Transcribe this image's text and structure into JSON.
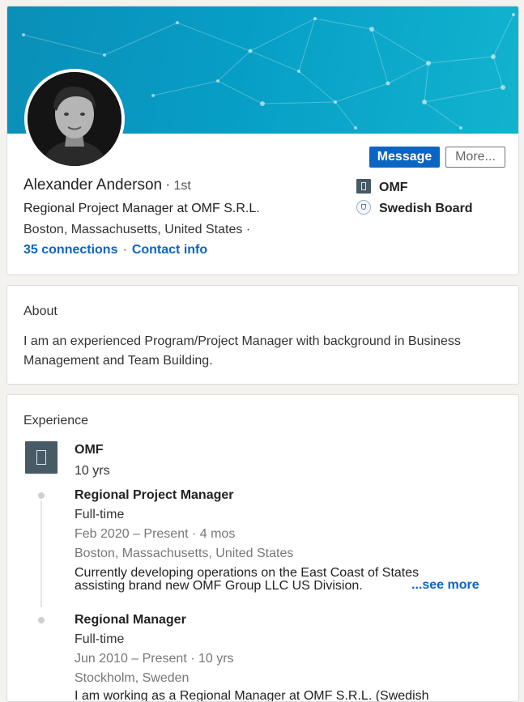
{
  "profile": {
    "name": "Alexander Anderson",
    "degree": "1st",
    "headline": "Regional Project Manager at OMF S.R.L.",
    "location": "Boston, Massachusetts, United States",
    "connections": "35 connections",
    "contact_info": "Contact info",
    "message_label": "Message",
    "more_label": "More...",
    "orgs": [
      {
        "name": "OMF",
        "icon": "building-icon"
      },
      {
        "name": "Swedish Board",
        "icon": "crest-icon"
      }
    ],
    "colors": {
      "primary": "#0a66c2",
      "banner": "#079ec6"
    }
  },
  "about": {
    "title": "About",
    "text": "I am an experienced Program/Project Manager with background in Business Management and Team Building."
  },
  "experience": {
    "title": "Experience",
    "company": "OMF",
    "company_duration": "10 yrs",
    "roles": [
      {
        "title": "Regional Project Manager",
        "type": "Full-time",
        "dates": "Feb 2020 – Present · 4 mos",
        "location": "Boston, Massachusetts, United States",
        "description": "Currently developing operations on the East Coast of States assisting brand new OMF Group LLC US Division.",
        "see_more": "...see more"
      },
      {
        "title": "Regional Manager",
        "type": "Full-time",
        "dates": "Jun 2010 – Present · 10 yrs",
        "location": "Stockholm, Sweden",
        "description": "I am working as a Regional Manager at OMF S.R.L. (Swedish"
      }
    ]
  }
}
